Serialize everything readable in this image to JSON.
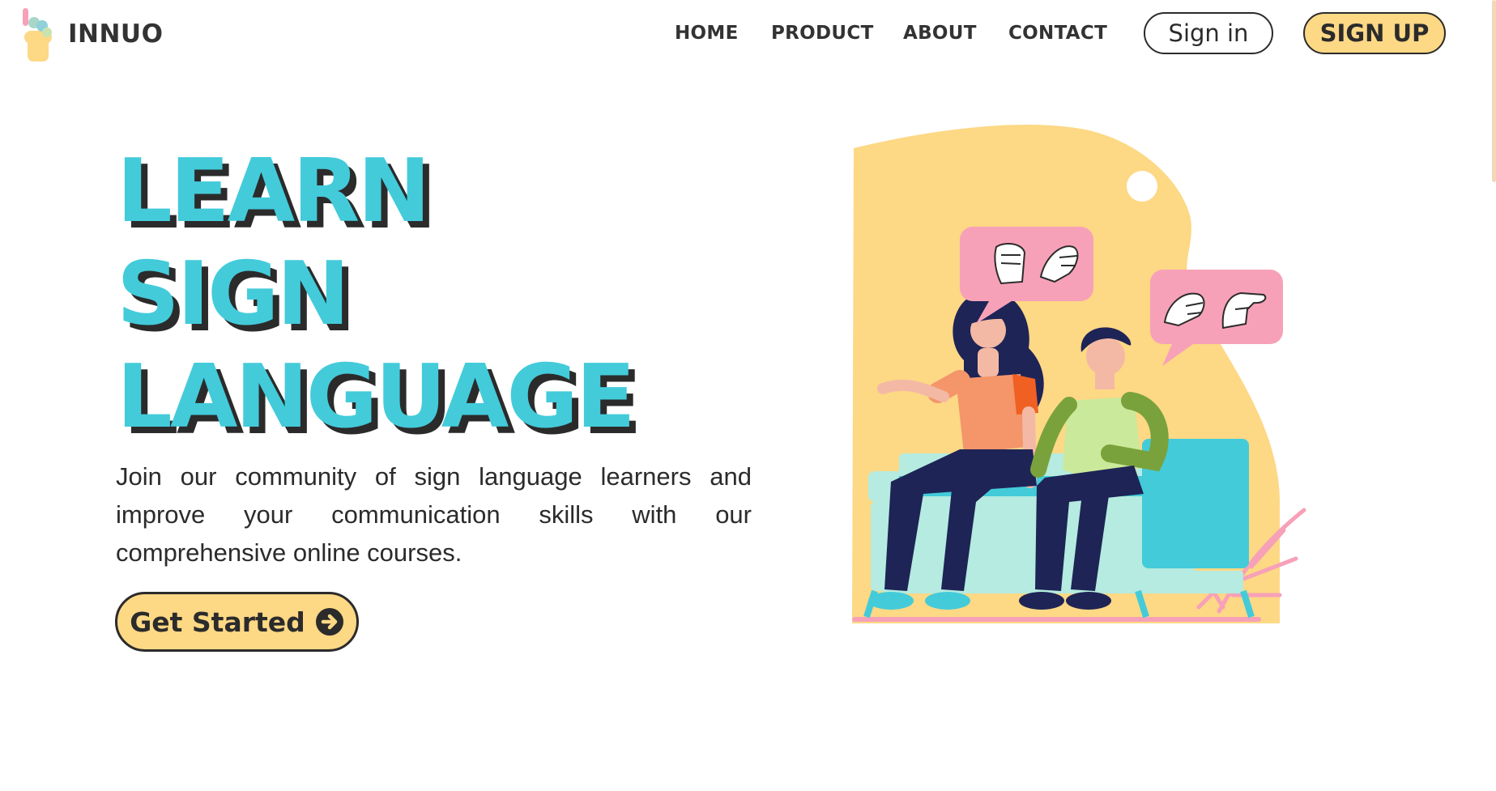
{
  "brand": {
    "name": "INNUO",
    "logo_icon": "hand-logo-icon"
  },
  "nav": {
    "items": [
      "HOME",
      "PRODUCT",
      "ABOUT",
      "CONTACT"
    ]
  },
  "auth": {
    "signin_label": "Sign in",
    "signup_label": "SIGN UP"
  },
  "hero": {
    "title_lines": [
      "LEARN",
      "SIGN",
      "LANGUAGE"
    ],
    "description": "Join our community of sign language learners and improve your communication skills with our comprehensive online courses.",
    "cta_label": "Get Started",
    "cta_icon": "arrow-circle-right-icon"
  },
  "illustration": {
    "icon": "people-signing-illustration"
  },
  "colors": {
    "accent_teal": "#43cbda",
    "accent_yellow": "#fdd885",
    "text_dark": "#2b2b2b",
    "bubble_pink": "#f7a1b8"
  }
}
